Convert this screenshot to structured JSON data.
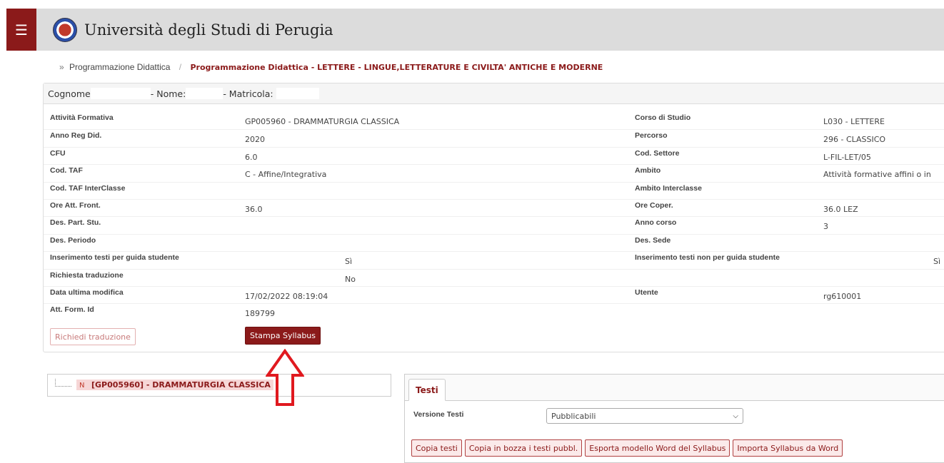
{
  "header": {
    "menu_icon": "☰",
    "university_name": "Università degli Studi di Perugia"
  },
  "breadcrumb": {
    "separator": "»",
    "parent": "Programmazione Didattica",
    "current": "Programmazione Didattica - LETTERE - LINGUE,LETTERATURE E CIVILTA' ANTICHE E MODERNE"
  },
  "student": {
    "cognome_label": "Cognome",
    "nome_label": "- Nome:",
    "matricola_label": "- Matricola:"
  },
  "details": {
    "left": [
      {
        "label": "Attività Formativa",
        "value": "GP005960 - DRAMMATURGIA CLASSICA"
      },
      {
        "label": "Anno Reg Did.",
        "value": "2020"
      },
      {
        "label": "CFU",
        "value": "6.0"
      },
      {
        "label": "Cod. TAF",
        "value": "C - Affine/Integrativa"
      },
      {
        "label": "Cod. TAF InterClasse",
        "value": ""
      },
      {
        "label": "Ore Att. Front.",
        "value": "36.0"
      },
      {
        "label": "Des. Part. Stu.",
        "value": ""
      },
      {
        "label": "Des. Periodo",
        "value": ""
      },
      {
        "label": "Inserimento testi per guida studente",
        "value": "Sì"
      },
      {
        "label": "Richiesta traduzione",
        "value": "No"
      },
      {
        "label": "Data ultima modifica",
        "value": "17/02/2022 08:19:04"
      },
      {
        "label": "Att. Form. Id",
        "value": "189799"
      }
    ],
    "right": [
      {
        "label": "Corso di Studio",
        "value": "L030 - LETTERE"
      },
      {
        "label": "Percorso",
        "value": "296 - CLASSICO"
      },
      {
        "label": "Cod. Settore",
        "value": "L-FIL-LET/05"
      },
      {
        "label": "Ambito",
        "value": "Attività formative affini o in"
      },
      {
        "label": "Ambito Interclasse",
        "value": ""
      },
      {
        "label": "Ore Coper.",
        "value": "36.0 LEZ"
      },
      {
        "label": "Anno corso",
        "value": "3"
      },
      {
        "label": "Des. Sede",
        "value": ""
      },
      {
        "label": "Inserimento testi non per guida studente",
        "value": "Sì"
      },
      {
        "label": "",
        "value": ""
      },
      {
        "label": "Utente",
        "value": "rg610001"
      },
      {
        "label": "",
        "value": ""
      }
    ]
  },
  "buttons": {
    "richiedi_traduzione": "Richiedi traduzione",
    "stampa_syllabus": "Stampa Syllabus"
  },
  "tree": {
    "node_badge": "N",
    "node_label": "[GP005960] - DRAMMATURGIA CLASSICA"
  },
  "tabs": {
    "active_tab": "Testi",
    "versione_label": "Versione Testi",
    "versione_selected": "Pubblicabili",
    "actions": [
      "Copia testi",
      "Copia in bozza i testi pubbl.",
      "Esporta modello Word del Syllabus",
      "Importa Syllabus da Word"
    ]
  },
  "colors": {
    "brand": "#8b1a1a",
    "annotation_arrow": "#e0191f"
  },
  "icons": {
    "menu": "hamburger-menu-icon",
    "logo": "university-seal-logo",
    "select": "chevron-down-icon",
    "annotation": "up-arrow-annotation-icon"
  }
}
